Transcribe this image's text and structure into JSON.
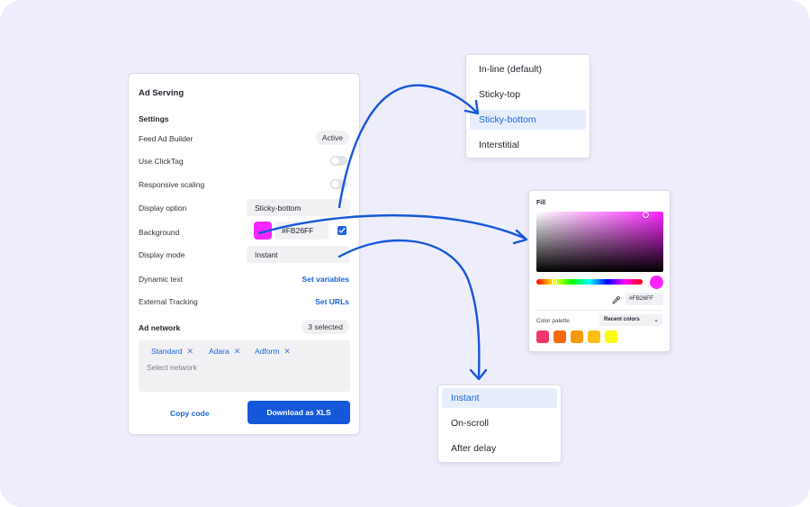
{
  "panel": {
    "title": "Ad Serving",
    "settings_heading": "Settings",
    "feed_ad_builder": {
      "label": "Feed Ad Builder",
      "status": "Active"
    },
    "use_clicktag": {
      "label": "Use ClickTag",
      "enabled": false
    },
    "responsive_scaling": {
      "label": "Responsive scaling",
      "enabled": false
    },
    "display_option": {
      "label": "Display option",
      "value": "Sticky-bottom"
    },
    "background": {
      "label": "Background",
      "color": "#FB26FF",
      "hex": "#FB26FF",
      "checked": true
    },
    "display_mode": {
      "label": "Display mode",
      "value": "Instant"
    },
    "dynamic_text": {
      "label": "Dynamic text",
      "action": "Set variables"
    },
    "external_tracking": {
      "label": "External Tracking",
      "action": "Set URLs"
    },
    "ad_network": {
      "label": "Ad network",
      "count": "3 selected",
      "tags": [
        "Standard",
        "Adara",
        "Adform"
      ],
      "remove_icon": "close-icon",
      "placeholder": "Select network"
    },
    "copy_code": "Copy code",
    "download": "Download as XLS"
  },
  "display_option_menu": {
    "items": [
      "In-line (default)",
      "Sticky-top",
      "Sticky-bottom",
      "Interstitial"
    ],
    "selected": "Sticky-bottom"
  },
  "color_picker": {
    "title": "Fill",
    "hex": "#FB26FF",
    "eyedropper_icon": "eyedropper-icon",
    "palette_label": "Color palette",
    "palette_select": "Recent colors",
    "palette_colors": [
      "#F2386A",
      "#F56A0C",
      "#F79A0A",
      "#FAC014",
      "#FAFA14"
    ]
  },
  "display_mode_menu": {
    "items": [
      "Instant",
      "On-scroll",
      "After delay"
    ],
    "selected": "Instant"
  },
  "colors": {
    "accent": "#1557D9",
    "link": "#1A63D8",
    "canvas": "#EEEDFC",
    "arrow": "#1557D9"
  }
}
